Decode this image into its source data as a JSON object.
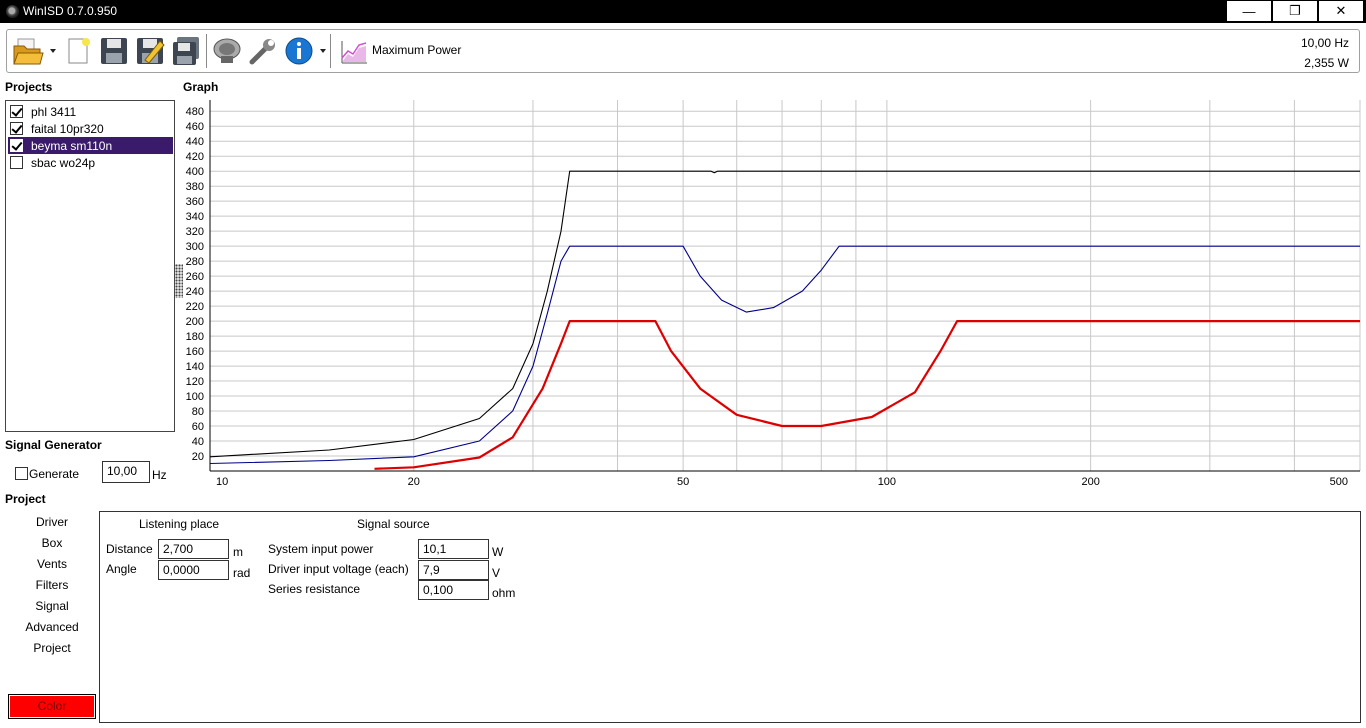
{
  "window": {
    "title": "WinISD 0.7.0.950",
    "buttons": {
      "minimize": "—",
      "restore": "❐",
      "close": "✕"
    }
  },
  "toolbar": {
    "icons": [
      "open-folder-icon",
      "new-document-icon",
      "save-icon",
      "save-as-icon",
      "save-all-icon",
      "driver-speaker-icon",
      "settings-wrench-icon",
      "info-icon",
      "graph-type-icon"
    ],
    "mode_label": "Maximum Power",
    "readout_freq": "10,00 Hz",
    "readout_power": "2,355 W"
  },
  "projects": {
    "label": "Projects",
    "items": [
      {
        "name": "phl 3411",
        "checked": true,
        "selected": false
      },
      {
        "name": "faital 10pr320",
        "checked": true,
        "selected": false
      },
      {
        "name": "beyma sm110n",
        "checked": true,
        "selected": true
      },
      {
        "name": "sbac wo24p",
        "checked": false,
        "selected": false
      }
    ]
  },
  "signal_generator": {
    "label": "Signal Generator",
    "generate_label": "Generate",
    "generate_checked": false,
    "frequency": "10,00",
    "unit": "Hz"
  },
  "project_nav": {
    "label": "Project",
    "items": [
      "Driver",
      "Box",
      "Vents",
      "Filters",
      "Signal",
      "Advanced",
      "Project"
    ],
    "color_button": "Color"
  },
  "panel": {
    "listening_place_title": "Listening place",
    "signal_source_title": "Signal source",
    "distance_label": "Distance",
    "distance_value": "2,700",
    "distance_unit": "m",
    "angle_label": "Angle",
    "angle_value": "0,0000",
    "angle_unit": "rad",
    "system_input_power_label": "System input power",
    "system_input_power_value": "10,1",
    "system_input_power_unit": "W",
    "driver_input_voltage_label": "Driver input voltage (each)",
    "driver_input_voltage_value": "7,9",
    "driver_input_voltage_unit": "V",
    "series_resistance_label": "Series resistance",
    "series_resistance_value": "0,100",
    "series_resistance_unit": "ohm"
  },
  "graph": {
    "label": "Graph"
  },
  "chart_data": {
    "type": "line",
    "title": "",
    "x_scale": "log",
    "xlim": [
      10,
      500
    ],
    "ylim": [
      0,
      495
    ],
    "x_tick_labels": [
      10,
      20,
      50,
      100,
      200,
      500
    ],
    "y_tick_labels": [
      20,
      40,
      60,
      80,
      100,
      120,
      140,
      160,
      180,
      200,
      220,
      240,
      260,
      280,
      300,
      320,
      340,
      360,
      380,
      400,
      420,
      440,
      460,
      480
    ],
    "grid": true,
    "legend": "none",
    "series": [
      {
        "color": "#000000",
        "points": [
          [
            10,
            19
          ],
          [
            15,
            28
          ],
          [
            20,
            42
          ],
          [
            25,
            70
          ],
          [
            28,
            110
          ],
          [
            30,
            170
          ],
          [
            31.5,
            240
          ],
          [
            33,
            320
          ],
          [
            34,
            400
          ],
          [
            50,
            400
          ],
          [
            55,
            400
          ],
          [
            55.6,
            398
          ],
          [
            56.2,
            400
          ],
          [
            500,
            400
          ]
        ]
      },
      {
        "color": "#00008b",
        "points": [
          [
            10,
            10
          ],
          [
            15,
            14
          ],
          [
            20,
            19
          ],
          [
            25,
            40
          ],
          [
            28,
            80
          ],
          [
            30,
            140
          ],
          [
            31.5,
            210
          ],
          [
            33,
            280
          ],
          [
            34,
            300
          ],
          [
            50,
            300
          ],
          [
            53,
            260
          ],
          [
            57,
            228
          ],
          [
            62,
            212
          ],
          [
            68,
            218
          ],
          [
            75,
            240
          ],
          [
            80,
            268
          ],
          [
            85,
            300
          ],
          [
            500,
            300
          ]
        ]
      },
      {
        "color": "#dd0000",
        "points": [
          [
            17.5,
            3
          ],
          [
            20,
            5
          ],
          [
            25,
            18
          ],
          [
            28,
            45
          ],
          [
            31,
            110
          ],
          [
            33,
            170
          ],
          [
            34,
            200
          ],
          [
            45.5,
            200
          ],
          [
            48,
            160
          ],
          [
            53,
            110
          ],
          [
            60,
            75
          ],
          [
            70,
            60
          ],
          [
            80,
            60
          ],
          [
            95,
            72
          ],
          [
            110,
            105
          ],
          [
            120,
            160
          ],
          [
            127,
            200
          ],
          [
            500,
            200
          ]
        ]
      }
    ]
  }
}
